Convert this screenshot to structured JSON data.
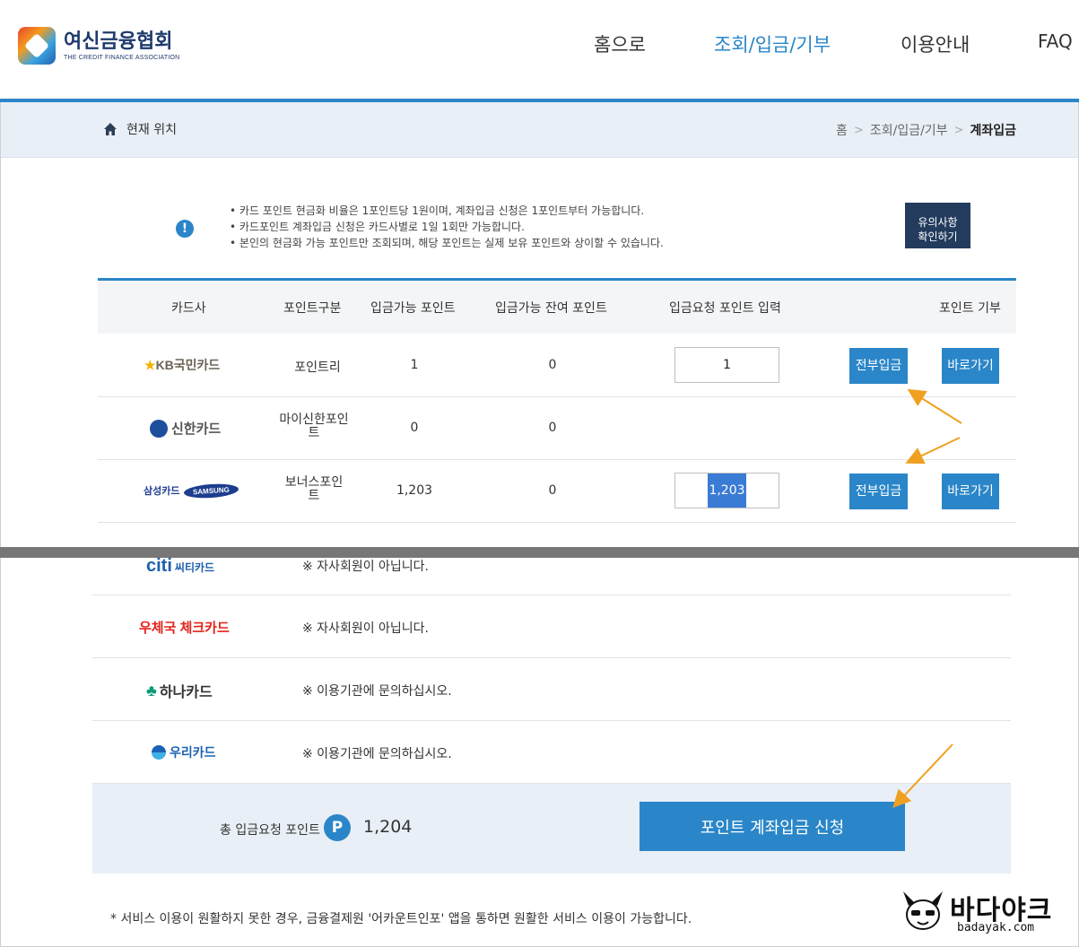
{
  "header": {
    "logo_kr": "여신금융협회",
    "logo_en": "THE CREDIT FINANCE ASSOCIATION",
    "nav": [
      "홈으로",
      "조회/입금/기부",
      "이용안내",
      "FAQ"
    ]
  },
  "location": {
    "label": "현재 위치",
    "breadcrumb": [
      "홈",
      "조회/입금/기부",
      "계좌입금"
    ]
  },
  "notice": {
    "lines": [
      "카드 포인트 현금화 비율은 1포인트당 1원이며, 계좌입금 신청은 1포인트부터 가능합니다.",
      "카드포인트 계좌입금 신청은 카드사별로 1일 1회만 가능합니다.",
      "본인의 현금화 가능 포인트만 조회되며, 해당 포인트는 실제 보유 포인트와 상이할 수 있습니다."
    ],
    "button_line1": "유의사항",
    "button_line2": "확인하기"
  },
  "table": {
    "headers": [
      "카드사",
      "포인트구분",
      "입금가능 포인트",
      "입금가능 잔여 포인트",
      "입금요청 포인트 입력",
      "포인트 기부"
    ],
    "rows": [
      {
        "card": "KB국민카드",
        "point_type": "포인트리",
        "available": "1",
        "remaining": "0",
        "input": "1",
        "all_label": "전부입금",
        "go_label": "바로가기"
      },
      {
        "card": "신한카드",
        "point_type": "마이신한포인트",
        "available": "0",
        "remaining": "0"
      },
      {
        "card": "삼성카드",
        "card_sub": "SAMSUNG",
        "point_type": "보너스포인트",
        "available": "1,203",
        "remaining": "0",
        "input": "1,203",
        "all_label": "전부입금",
        "go_label": "바로가기"
      }
    ],
    "lower_rows": [
      {
        "card": "씨티카드",
        "card_brand": "citi",
        "message": "※ 자사회원이 아닙니다."
      },
      {
        "card": "우체국 체크카드",
        "message": "※ 자사회원이 아닙니다."
      },
      {
        "card": "하나카드",
        "message": "※ 이용기관에 문의하십시오."
      },
      {
        "card": "우리카드",
        "message": "※ 이용기관에 문의하십시오."
      }
    ]
  },
  "summary": {
    "label": "총 입금요청 포인트",
    "badge": "P",
    "value": "1,204",
    "apply_button": "포인트 계좌입금 신청"
  },
  "footnote": "* 서비스 이용이 원활하지 못한 경우, 금융결제원 '어카운트인포' 앱을 통하면 원활한 서비스 이용이 가능합니다.",
  "watermark": {
    "text": "바다야크",
    "sub": "badayak.com"
  },
  "colors": {
    "accent": "#2a86c8",
    "navy": "#233c5e",
    "annotation_arrow": "#f0a020"
  },
  "icons": [
    "home-icon",
    "info-icon",
    "p-badge-icon",
    "arrow-annotation"
  ]
}
